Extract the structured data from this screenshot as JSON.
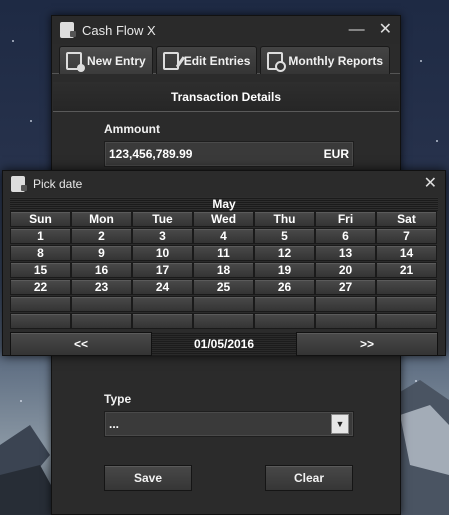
{
  "main_window": {
    "title": "Cash Flow X",
    "minimize_glyph": "—",
    "close_glyph": "✕",
    "tabs": [
      {
        "label": "New Entry",
        "icon": "new-entry-icon",
        "active": true
      },
      {
        "label": "Edit Entries",
        "icon": "edit-entries-icon",
        "active": false
      },
      {
        "label": "Monthly Reports",
        "icon": "monthly-reports-icon",
        "active": false
      }
    ],
    "section_title": "Transaction Details",
    "amount": {
      "label": "Ammount",
      "value": "123,456,789.99",
      "currency": "EUR"
    },
    "type": {
      "label": "Type",
      "value": "..."
    },
    "save_label": "Save",
    "clear_label": "Clear"
  },
  "date_dialog": {
    "title": "Pick date",
    "close_glyph": "✕",
    "month": "May",
    "weekdays": [
      "Sun",
      "Mon",
      "Tue",
      "Wed",
      "Thu",
      "Fri",
      "Sat"
    ],
    "weeks": [
      [
        "1",
        "2",
        "3",
        "4",
        "5",
        "6",
        "7"
      ],
      [
        "8",
        "9",
        "10",
        "11",
        "12",
        "13",
        "14"
      ],
      [
        "15",
        "16",
        "17",
        "18",
        "19",
        "20",
        "21"
      ],
      [
        "22",
        "23",
        "24",
        "25",
        "26",
        "27",
        ""
      ],
      [
        "",
        "",
        "",
        "",
        "",
        "",
        ""
      ],
      [
        "",
        "",
        "",
        "",
        "",
        "",
        ""
      ]
    ],
    "prev_label": "<<",
    "next_label": ">>",
    "current_date": "01/05/2016"
  },
  "colors": {
    "window_bg": "#2b2b2b",
    "button_top": "#4a4a4a",
    "button_bottom": "#343434",
    "text": "#ffffff"
  }
}
